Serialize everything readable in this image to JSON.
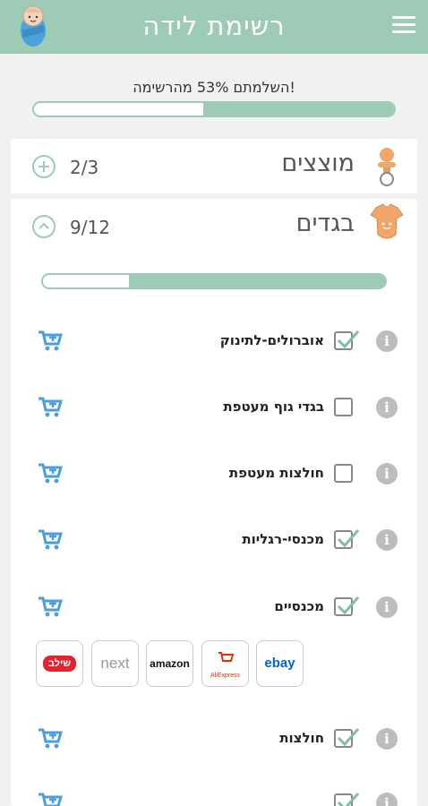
{
  "header": {
    "title": "רשימת לידה",
    "menu_icon": "menu-icon",
    "logo_icon": "swaddled-baby-icon"
  },
  "overall_progress": {
    "label": "השלמתם 53% מהרשימה!",
    "percent": 53
  },
  "categories": [
    {
      "title": "מוצצים",
      "count": "2/3",
      "icon": "pacifier-icon",
      "expanded": false
    },
    {
      "title": "בגדים",
      "count": "9/12",
      "icon": "onesie-icon",
      "expanded": true,
      "progress_fraction": 0.75
    }
  ],
  "items": [
    {
      "name": "אוברולים-לתינוק",
      "checked": true
    },
    {
      "name": "בגדי גוף מעטפת",
      "checked": false
    },
    {
      "name": "חולצות מעטפת",
      "checked": false
    },
    {
      "name": "מכנסי-רגליות",
      "checked": true
    },
    {
      "name": "מכנסיים",
      "checked": true
    },
    {
      "name": "חולצות",
      "checked": true
    },
    {
      "name": "",
      "checked": true
    }
  ],
  "stores": [
    {
      "name": "ebay"
    },
    {
      "name": "AliExpress"
    },
    {
      "name": "amazon"
    },
    {
      "name": "next"
    },
    {
      "name": "שילב"
    }
  ],
  "colors": {
    "accent": "#9ecbb6",
    "cart": "#4a9fdc",
    "info": "#bdbdbd",
    "check": "#7fbfa4"
  }
}
